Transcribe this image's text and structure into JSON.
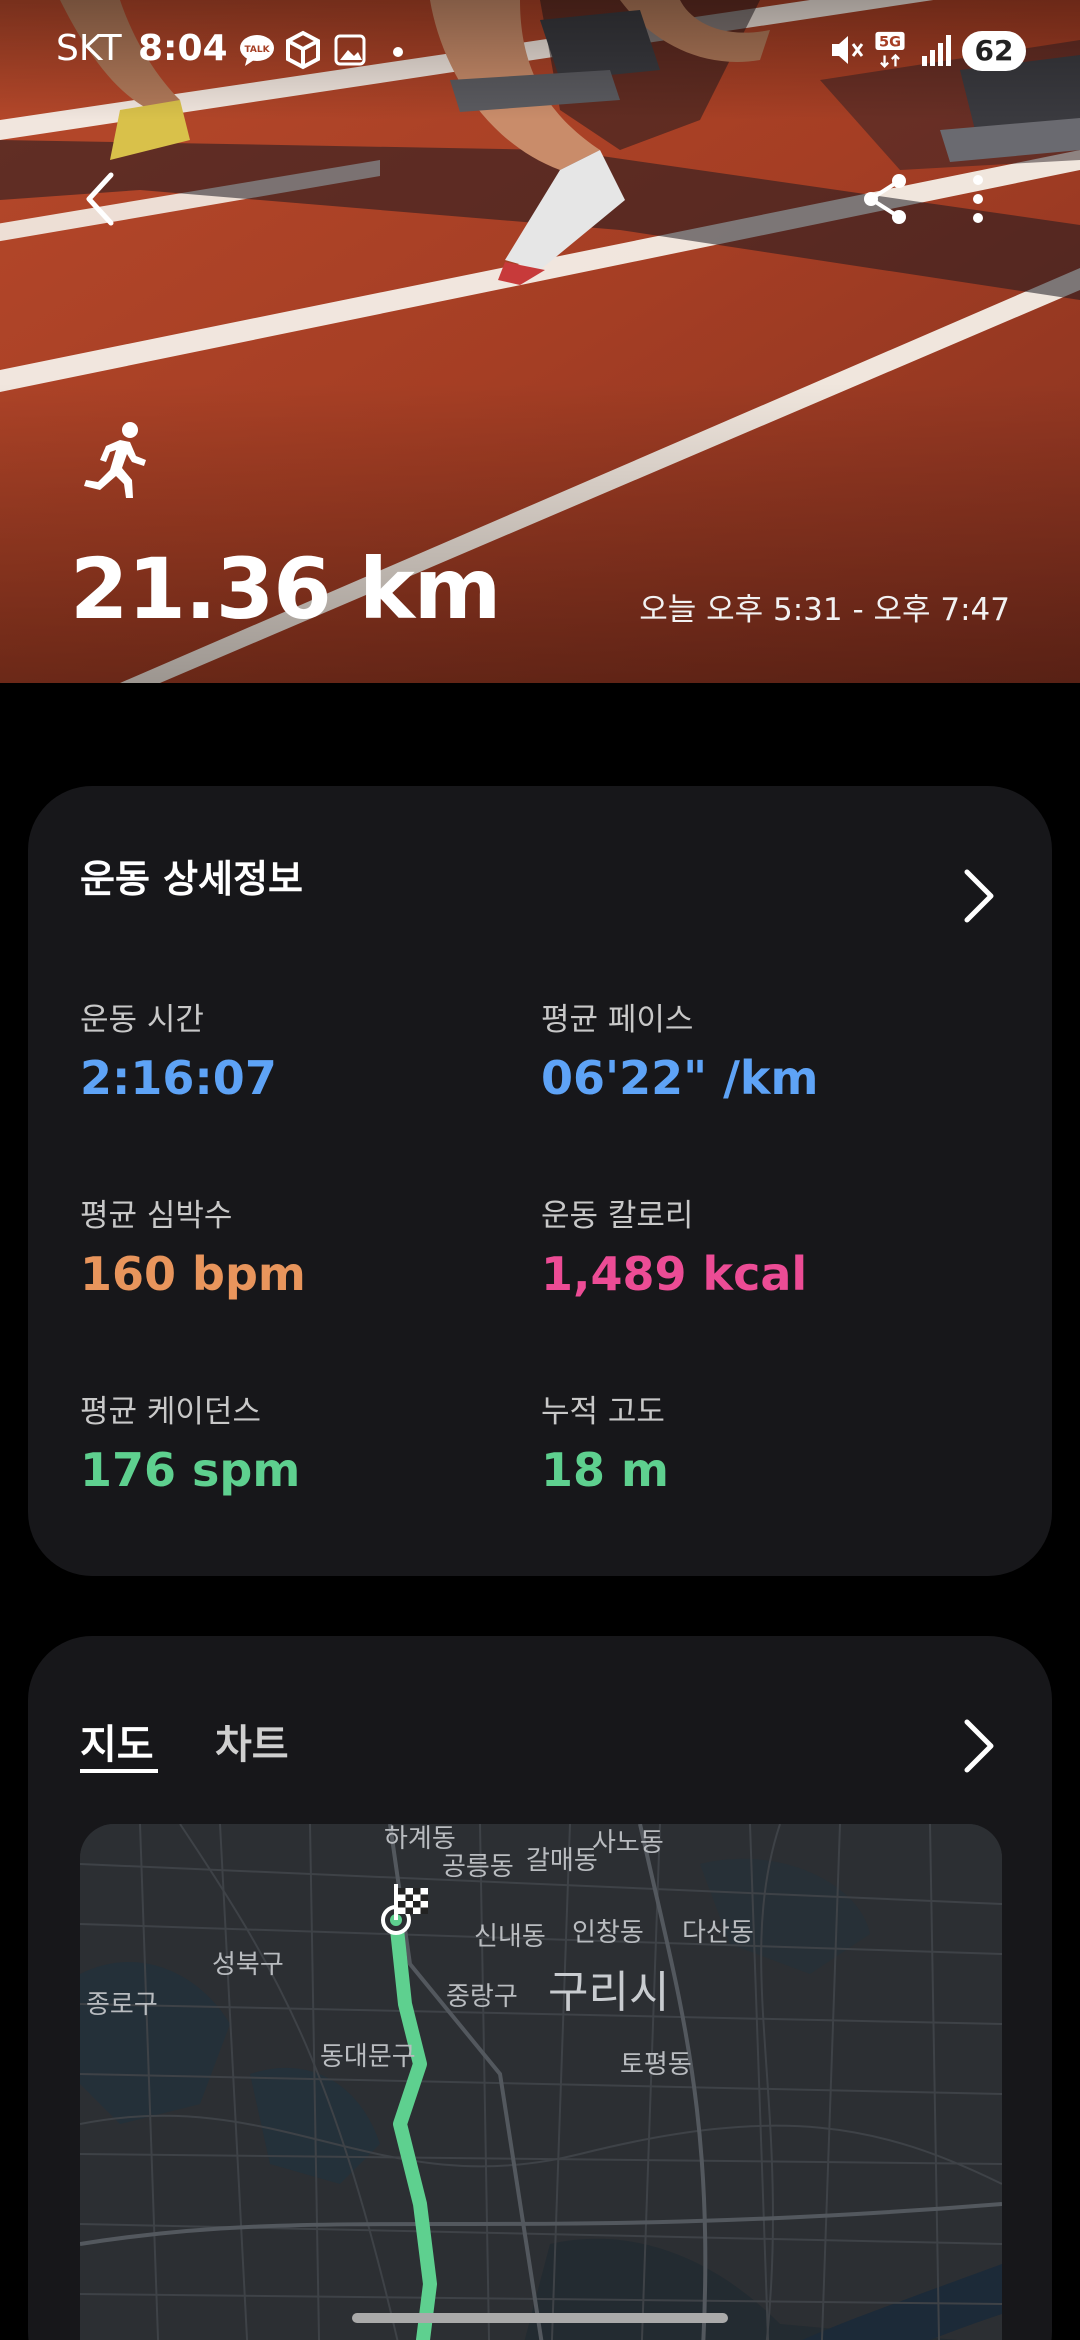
{
  "status_bar": {
    "carrier": "SKT",
    "time": "8:04",
    "network": "5G",
    "battery": "62",
    "icons": [
      "talk-icon",
      "package-icon",
      "gallery-icon",
      "dot-icon",
      "mute-icon",
      "5g-icon",
      "signal-icon",
      "battery-icon"
    ]
  },
  "hero": {
    "activity_icon": "running-icon",
    "distance": "21.36 km",
    "time_range": "오늘 오후 5:31 - 오후 7:47",
    "colors": {
      "track": "#a53e24",
      "lane_line": "#f4efe8"
    }
  },
  "toolbar": {
    "back_icon": "back-arrow-icon",
    "share_icon": "share-icon",
    "more_icon": "more-vert-icon"
  },
  "details": {
    "title": "운동 상세정보",
    "stats": [
      {
        "label": "운동 시간",
        "value": "2:16:07",
        "color": "#5ea3f6"
      },
      {
        "label": "평균 페이스",
        "value": "06'22\" /km",
        "color": "#5ea3f6"
      },
      {
        "label": "평균 심박수",
        "value": "160 bpm",
        "color": "#e8955c"
      },
      {
        "label": "운동 칼로리",
        "value": "1,489 kcal",
        "color": "#ec4c95"
      },
      {
        "label": "평균 케이던스",
        "value": "176 spm",
        "color": "#5ed08f"
      },
      {
        "label": "누적 고도",
        "value": "18 m",
        "color": "#5ed08f"
      }
    ]
  },
  "map_card": {
    "tabs": [
      {
        "label": "지도",
        "active": true
      },
      {
        "label": "차트",
        "active": false
      }
    ],
    "places": [
      "하계동",
      "공릉동",
      "갈매동",
      "사노동",
      "신내동",
      "인창동",
      "다산동",
      "성북구",
      "중랑구",
      "구리시",
      "종로구",
      "동대문구",
      "토평동"
    ],
    "route_color": "#5ed08f"
  }
}
